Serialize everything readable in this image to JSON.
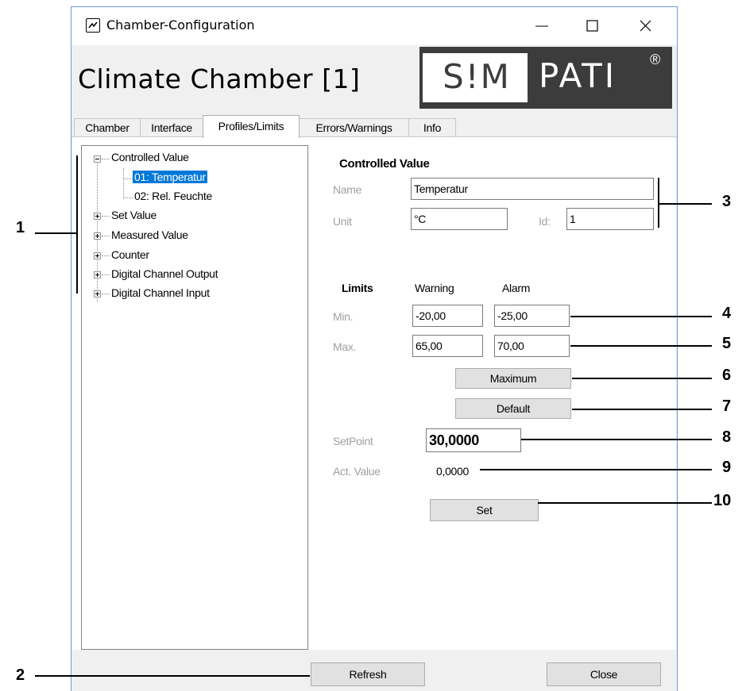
{
  "window": {
    "title": "Chamber-Configuration",
    "minimize_glyph": "—",
    "maximize_glyph": "☐",
    "close_glyph": "✕"
  },
  "header": {
    "title": "Climate Chamber [1]",
    "logo_left": "S!M",
    "logo_right": "PATI",
    "logo_reg": "®"
  },
  "tabs": [
    {
      "label": "Chamber",
      "active": false
    },
    {
      "label": "Interface",
      "active": false
    },
    {
      "label": "Profiles/Limits",
      "active": true
    },
    {
      "label": "Errors/Warnings",
      "active": false
    },
    {
      "label": "Info",
      "active": false
    }
  ],
  "tree": {
    "root_label": "Controlled Value",
    "children": [
      "01: Temperatur",
      "02: Rel. Feuchte"
    ],
    "selected": "01: Temperatur",
    "collapsed_nodes": [
      "Set Value",
      "Measured Value",
      "Counter",
      "Digital Channel Output",
      "Digital Channel Input"
    ]
  },
  "controlled_value": {
    "heading": "Controlled Value",
    "name_label": "Name",
    "name_value": "Temperatur",
    "unit_label": "Unit",
    "unit_value": "°C",
    "id_label": "Id:",
    "id_value": "1"
  },
  "limits": {
    "heading": "Limits",
    "warning_label": "Warning",
    "alarm_label": "Alarm",
    "min_label": "Min.",
    "max_label": "Max.",
    "min_warning": "-20,00",
    "min_alarm": "-25,00",
    "max_warning": "65,00",
    "max_alarm": "70,00",
    "maximum_button": "Maximum",
    "default_button": "Default"
  },
  "setpoint": {
    "setpoint_label": "SetPoint",
    "setpoint_value": "30,0000",
    "act_label": "Act. Value",
    "act_value": "0,0000",
    "set_button": "Set"
  },
  "footer": {
    "refresh_button": "Refresh",
    "close_button": "Close"
  },
  "callouts": [
    "1",
    "2",
    "3",
    "4",
    "5",
    "6",
    "7",
    "8",
    "9",
    "10"
  ],
  "colors": {
    "selection": "#0078d7",
    "window_border": "#6e9ad6",
    "logo_dark": "#3c3c3c",
    "label_gray": "#a0a0a0"
  }
}
